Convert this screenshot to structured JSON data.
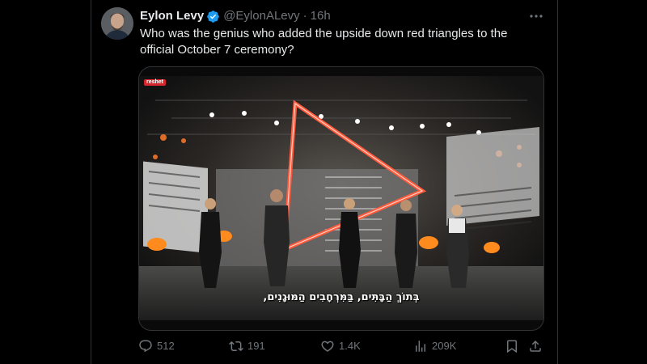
{
  "post": {
    "author_name": "Eylon Levy",
    "author_handle": "@EylonALevy",
    "separator": "·",
    "time": "16h",
    "verified": true,
    "text": "Who was the genius who added the upside down red triangles to the official October 7 ceremony?",
    "video": {
      "channel_badge": "reshet",
      "subtitle": "בְּתוֹךְ הַבָּתִּים, בַּמִּרְחָבִים הַמּוּגָנִים,"
    },
    "actions": {
      "replies": "512",
      "reposts": "191",
      "likes": "1.4K",
      "views": "209K"
    }
  },
  "colors": {
    "background": "#000000",
    "text_primary": "#e7e9ea",
    "text_secondary": "#71767b",
    "border": "#2f3336",
    "verified_blue": "#1d9bf0",
    "triangle": "#ff5a3c"
  },
  "icons": [
    "verified-badge-icon",
    "more-icon",
    "reply-icon",
    "repost-icon",
    "like-icon",
    "views-icon",
    "bookmark-icon",
    "share-icon"
  ]
}
